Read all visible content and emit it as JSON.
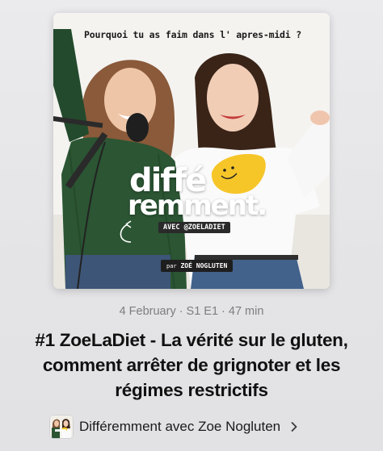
{
  "episode": {
    "artwork": {
      "headline": "Pourquoi tu as faim dans l' apres-midi ?",
      "brand_line1": "diffé",
      "brand_line2": "remment.",
      "host_tag": "AVEC @ZOELADIET",
      "producer_prefix": "par",
      "producer_name": "ZOÉ NOGLUTEN"
    },
    "date": "4 February",
    "season_episode": "S1 E1",
    "duration": "47 min",
    "separator": "·",
    "title": "#1 ZoeLaDiet - La vérité sur le gluten, comment arrêter de grignoter et les régimes restrictifs"
  },
  "show": {
    "name": "Différemment avec Zoe Nogluten",
    "chevron_icon": "chevron-right-icon"
  },
  "colors": {
    "accent_yellow": "#f6c629",
    "meta_gray": "#7d7d82",
    "title_black": "#111111"
  }
}
